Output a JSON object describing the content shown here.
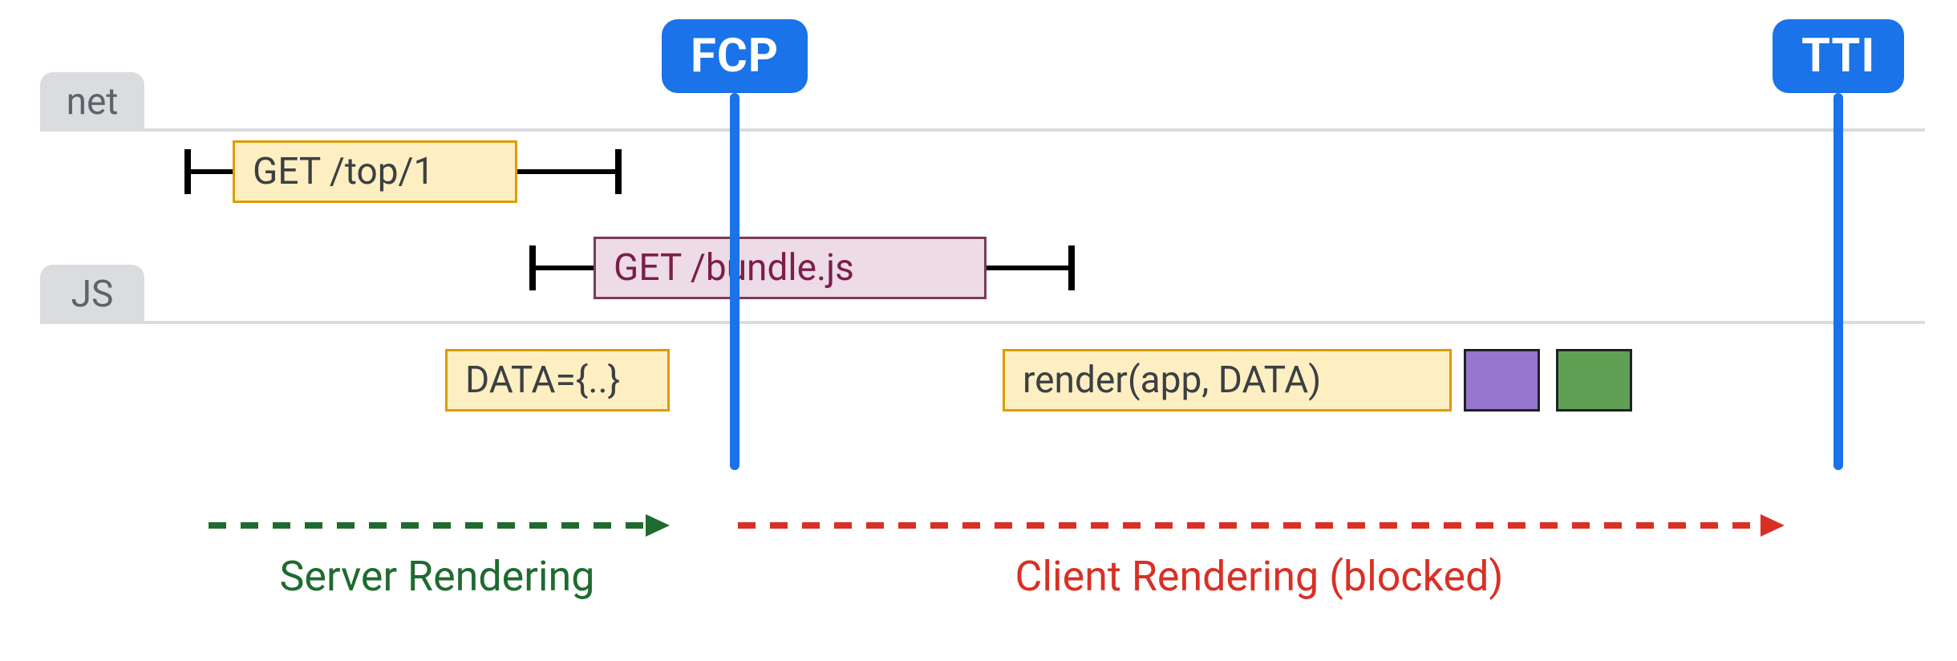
{
  "metrics": {
    "fcp": "FCP",
    "tti": "TTI"
  },
  "lanes": {
    "net": "net",
    "js": "JS"
  },
  "net": {
    "req1": "GET /top/1",
    "req2": "GET /bundle.js"
  },
  "js": {
    "data": "DATA={..}",
    "render": "render(app, DATA)"
  },
  "legend": {
    "server": "Server Rendering",
    "client": "Client Rendering (blocked)"
  },
  "colors": {
    "metric": "#1a73e8",
    "server": "#1e6b2f",
    "client": "#d93025"
  }
}
